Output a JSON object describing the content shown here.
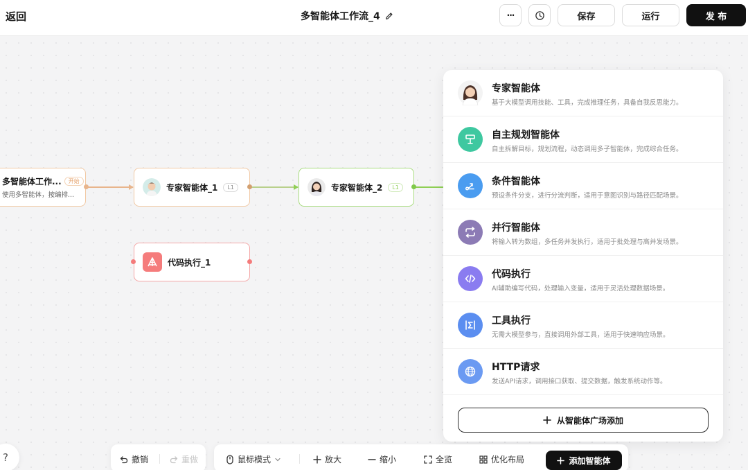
{
  "header": {
    "back_label": "返回",
    "title": "多智能体工作流_4",
    "more_label": "···",
    "save_label": "保存",
    "run_label": "运行",
    "publish_label": "发 布"
  },
  "nodes": {
    "start": {
      "label": "多智能体工作...",
      "tag": "开始",
      "desc": "使用多智能体，按编排..."
    },
    "expert1": {
      "label": "专家智能体_1",
      "tag": "L1"
    },
    "expert2": {
      "label": "专家智能体_2",
      "tag": "L1"
    },
    "code1": {
      "label": "代码执行_1"
    }
  },
  "panel": {
    "items": [
      {
        "title": "专家智能体",
        "desc": "基于大模型调用技能、工具，完成推理任务，具备自我反思能力。",
        "icon": "expert-avatar",
        "color": "#f5f5f5"
      },
      {
        "title": "自主规划智能体",
        "desc": "自主拆解目标，规划流程，动态调用多子智能体，完成综合任务。",
        "icon": "signpost-icon",
        "color": "#3ec8a0"
      },
      {
        "title": "条件智能体",
        "desc": "预设条件分支，进行分流判断，适用于意图识别与路径匹配场景。",
        "icon": "branch-icon",
        "color": "#4a9cf0"
      },
      {
        "title": "并行智能体",
        "desc": "将输入转为数组，多任务并发执行，适用于批处理与高并发场景。",
        "icon": "parallel-icon",
        "color": "#8c7bb5"
      },
      {
        "title": "代码执行",
        "desc": "AI辅助编写代码，处理输入变量，适用于灵活处理数据场景。",
        "icon": "code-icon",
        "color": "#8a7cf0"
      },
      {
        "title": "工具执行",
        "desc": "无需大模型参与，直接调用外部工具，适用于快速响应场景。",
        "icon": "sigma-icon",
        "color": "#5b8ef0"
      },
      {
        "title": "HTTP请求",
        "desc": "发送API请求，调用接口获取、提交数据，触发系统动作等。",
        "icon": "globe-icon",
        "color": "#6b9af2"
      }
    ],
    "add_from_plaza": "从智能体广场添加"
  },
  "toolbar": {
    "undo": "撤销",
    "redo": "重做",
    "mouse_mode": "鼠标模式",
    "zoom_in": "放大",
    "zoom_out": "缩小",
    "fit": "全览",
    "optimize": "优化布局",
    "add_agent": "添加智能体"
  },
  "help_label": "?"
}
